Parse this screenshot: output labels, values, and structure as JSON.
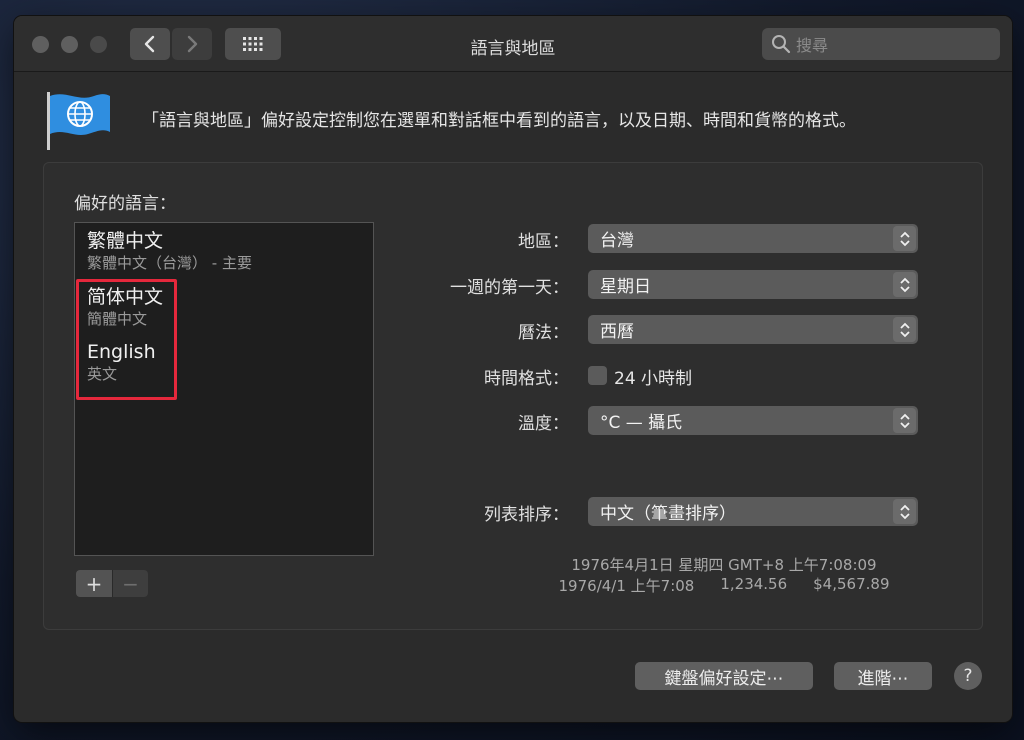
{
  "window": {
    "title": "語言與地區",
    "search_placeholder": "搜尋",
    "description": "「語言與地區」偏好設定控制您在選單和對話框中看到的語言，以及日期、時間和貨幣的格式。"
  },
  "languages": {
    "label": "偏好的語言：",
    "items": [
      {
        "name": "繁體中文",
        "sub": "繁體中文（台灣） - 主要"
      },
      {
        "name": "简体中文",
        "sub": "簡體中文"
      },
      {
        "name": "English",
        "sub": "英文"
      }
    ],
    "add_label": "+",
    "remove_label": "−"
  },
  "settings": {
    "region": {
      "label": "地區：",
      "value": "台灣"
    },
    "first_day": {
      "label": "一週的第一天：",
      "value": "星期日"
    },
    "calendar": {
      "label": "曆法：",
      "value": "西曆"
    },
    "time_format": {
      "label": "時間格式：",
      "checkbox_label": "24 小時制",
      "checked": false
    },
    "temperature": {
      "label": "溫度：",
      "value": "°C — 攝氏"
    },
    "list_sort": {
      "label": "列表排序：",
      "value": "中文（筆畫排序）"
    }
  },
  "sample": {
    "line1": "1976年4月1日 星期四 GMT+8 上午7:08:09",
    "date_short": "1976/4/1 上午7:08",
    "number": "1,234.56",
    "currency": "$4,567.89"
  },
  "buttons": {
    "keyboard": "鍵盤偏好設定⋯",
    "advanced": "進階⋯",
    "help": "?"
  },
  "colors": {
    "highlight": "#e5283c",
    "flag_blue": "#2f8ee0"
  }
}
